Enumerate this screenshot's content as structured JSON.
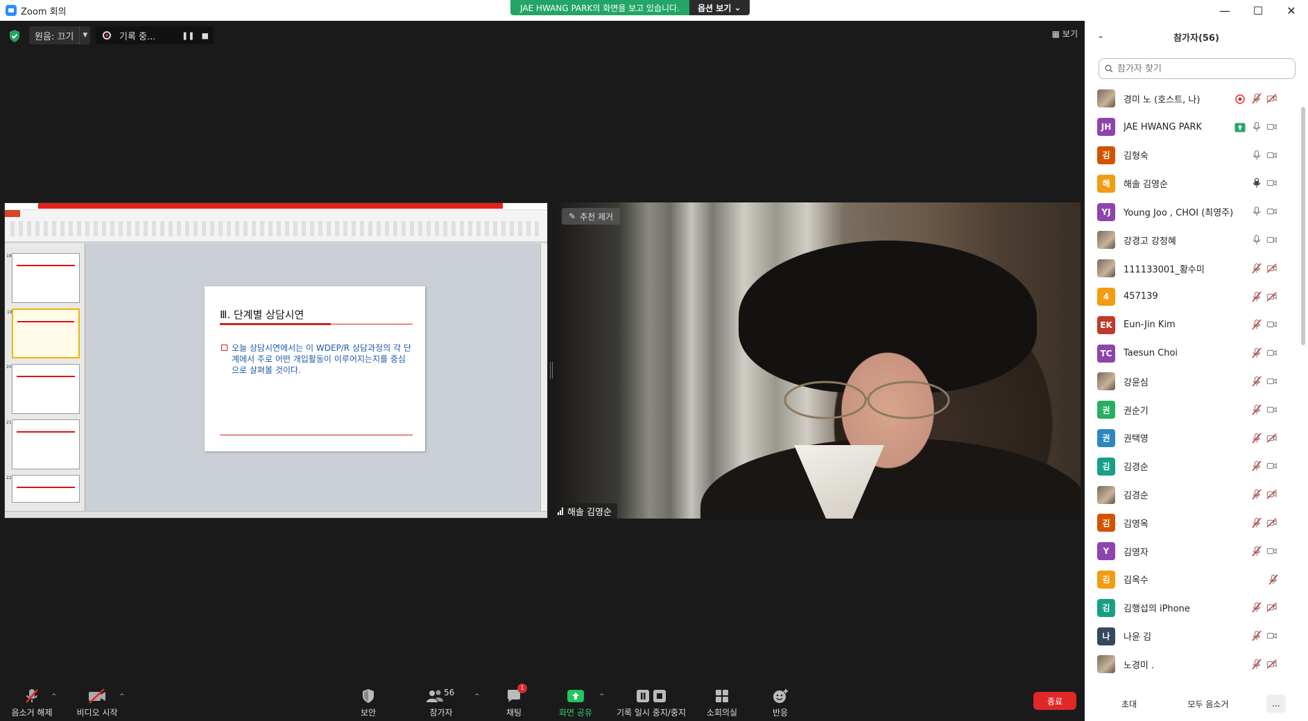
{
  "window": {
    "title": "Zoom 회의"
  },
  "banner": {
    "message": "JAE HWANG PARK의 화면을 보고 있습니다.",
    "options": "옵션 보기"
  },
  "top_controls": {
    "audio": "원음: 끄기",
    "recording": "기록 중..."
  },
  "view_label": "보기",
  "shared_slide": {
    "heading": "Ⅲ. 단계별 상담시연",
    "bullet": "오늘 상담시연에서는 이 WDEP/R 상담과정의 각 단계에서 주로 어떤 개입활동이 이루어지는지를 중심으로 살펴볼 것이다.",
    "thumb_numbers": [
      "18",
      "19",
      "20",
      "21",
      "22"
    ]
  },
  "video": {
    "unpin_label": "추천 제거",
    "speaker_name": "해솔 김영순"
  },
  "toolbar": {
    "mute": "음소거 해제",
    "video": "비디오 시작",
    "security": "보안",
    "participants": "참가자",
    "participants_count": "56",
    "chat": "채팅",
    "chat_badge": "1",
    "share": "화면 공유",
    "pause_record": "기록 일시 중지/중지",
    "breakout": "소회의실",
    "reactions": "반응",
    "end": "종료"
  },
  "panel": {
    "title": "참가자(56)",
    "search_placeholder": "참가자 찾기",
    "invite": "초대",
    "mute_all": "모두 음소거",
    "more": "...",
    "participants": [
      {
        "name": "경미 노 (호스트, 나)",
        "avatar": "",
        "color": "photo",
        "mic": "muted",
        "cam": "off",
        "rec": true
      },
      {
        "name": "JAE HWANG PARK",
        "avatar": "JH",
        "color": "#8e44ad",
        "mic": "on",
        "cam": "on",
        "share": true
      },
      {
        "name": "김형숙",
        "avatar": "김",
        "color": "#d35400",
        "mic": "on",
        "cam": "on"
      },
      {
        "name": "해솔 김영순",
        "avatar": "해",
        "color": "#f39c12",
        "mic": "active",
        "cam": "on"
      },
      {
        "name": "Young Joo , CHOI (최영주)",
        "avatar": "YJ",
        "color": "#8e44ad",
        "mic": "on",
        "cam": "on"
      },
      {
        "name": "강경고 강정혜",
        "avatar": "",
        "color": "photo",
        "mic": "on",
        "cam": "on"
      },
      {
        "name": "111133001_황수미",
        "avatar": "",
        "color": "photo",
        "mic": "muted",
        "cam": "off"
      },
      {
        "name": "457139",
        "avatar": "4",
        "color": "#f39c12",
        "mic": "muted",
        "cam": "off"
      },
      {
        "name": "Eun-Jin Kim",
        "avatar": "EK",
        "color": "#c0392b",
        "mic": "muted",
        "cam": "on"
      },
      {
        "name": "Taesun Choi",
        "avatar": "TC",
        "color": "#8e44ad",
        "mic": "muted",
        "cam": "on"
      },
      {
        "name": "강윤심",
        "avatar": "",
        "color": "photo",
        "mic": "muted",
        "cam": "on"
      },
      {
        "name": "권순기",
        "avatar": "권",
        "color": "#27ae60",
        "mic": "muted",
        "cam": "on"
      },
      {
        "name": "권택영",
        "avatar": "권",
        "color": "#2e86c1",
        "mic": "muted",
        "cam": "off"
      },
      {
        "name": "김경순",
        "avatar": "김",
        "color": "#16a085",
        "mic": "muted",
        "cam": "on"
      },
      {
        "name": "김경순",
        "avatar": "",
        "color": "photo",
        "mic": "muted",
        "cam": "off"
      },
      {
        "name": "김영옥",
        "avatar": "김",
        "color": "#d35400",
        "mic": "muted",
        "cam": "off"
      },
      {
        "name": "김영자",
        "avatar": "Y",
        "color": "#8e44ad",
        "mic": "muted",
        "cam": "on"
      },
      {
        "name": "김옥수",
        "avatar": "김",
        "color": "#f39c12",
        "mic": "none",
        "cam": "off"
      },
      {
        "name": "김행섭의 iPhone",
        "avatar": "김",
        "color": "#16a085",
        "mic": "muted",
        "cam": "off"
      },
      {
        "name": "나윤 김",
        "avatar": "나",
        "color": "#34495e",
        "mic": "muted",
        "cam": "on"
      },
      {
        "name": "노경미 .",
        "avatar": "",
        "color": "photo",
        "mic": "muted",
        "cam": "off"
      }
    ]
  }
}
